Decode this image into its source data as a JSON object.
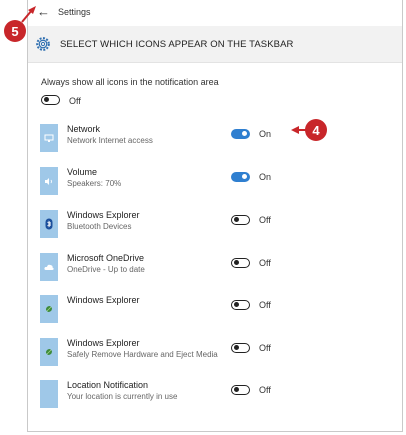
{
  "window": {
    "title": "Settings",
    "back_glyph": "←",
    "header_title": "SELECT WHICH ICONS APPEAR ON THE TASKBAR"
  },
  "always_show": {
    "label": "Always show all icons in the notification area",
    "state": "Off"
  },
  "items": [
    {
      "name": "Network",
      "sub": "Network Internet access",
      "state": "On",
      "icon": "network-icon"
    },
    {
      "name": "Volume",
      "sub": "Speakers: 70%",
      "state": "On",
      "icon": "volume-icon"
    },
    {
      "name": "Windows Explorer",
      "sub": "Bluetooth Devices",
      "state": "Off",
      "icon": "bluetooth-icon"
    },
    {
      "name": "Microsoft OneDrive",
      "sub": "OneDrive - Up to date",
      "state": "Off",
      "icon": "onedrive-icon"
    },
    {
      "name": "Windows Explorer",
      "sub": "",
      "state": "Off",
      "icon": "windows-explorer-icon"
    },
    {
      "name": "Windows Explorer",
      "sub": "Safely Remove Hardware and Eject Media",
      "state": "Off",
      "icon": "safely-remove-icon"
    },
    {
      "name": "Location Notification",
      "sub": "Your location is currently in use",
      "state": "Off",
      "icon": "location-icon"
    }
  ],
  "callouts": {
    "step_5": "5",
    "step_4": "4"
  },
  "colors": {
    "accent": "#2f7fd0",
    "callout": "#c8262a",
    "icon_tile": "#9fc8e8"
  }
}
